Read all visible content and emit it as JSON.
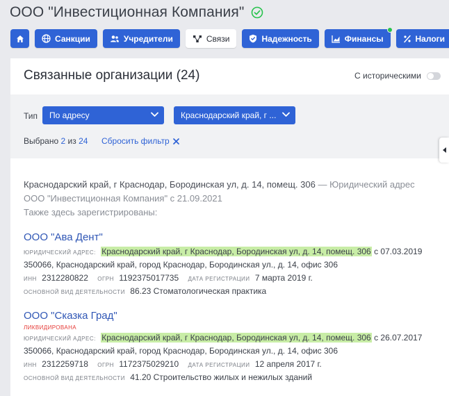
{
  "header": {
    "company_name": "ООО \"Инвестиционная Компания\""
  },
  "nav": {
    "items": [
      {
        "label": "Санкции"
      },
      {
        "label": "Учредители"
      },
      {
        "label": "Связи"
      },
      {
        "label": "Надежность"
      },
      {
        "label": "Финансы"
      },
      {
        "label": "Налоги"
      }
    ]
  },
  "panel": {
    "title": "Связанные организации (24)",
    "historic_label": "С историческими",
    "historic_enabled": false,
    "filter": {
      "type_label": "Тип",
      "type_value": "По адресу",
      "address_value": "Краснодарский край, г ...",
      "selected_prefix": "Выбрано",
      "selected_count": "2",
      "selected_of": "из",
      "selected_total": "24",
      "reset_label": "Сбросить фильтр"
    },
    "intro": {
      "line1_address": "Краснодарский край, г Краснодар, Бородинская ул, д. 14, помещ. 306",
      "line1_suffix": "— Юридический адрес",
      "line2": "ООО \"Инвестиционная Компания\" с 21.09.2021",
      "line3": "Также здесь зарегистрированы:"
    },
    "orgs": [
      {
        "name": "ООО \"Ава Дент\"",
        "status": "",
        "legal_address_label": "ЮРИДИЧЕСКИЙ АДРЕС:",
        "legal_address": "Краснодарский край, г Краснодар, Бородинская ул, д. 14, помещ. 306",
        "since": "с 07.03.2019",
        "postal_address": "350066, Краснодарский край, город Краснодар, Бородинская ул., д. 14, офис 306",
        "inn_label": "ИНН",
        "inn": "2312280822",
        "ogrn_label": "ОГРН",
        "ogrn": "1192375017735",
        "reg_label": "ДАТА РЕГИСТРАЦИИ",
        "reg_date": "7 марта 2019 г.",
        "activity_label": "ОСНОВНОЙ ВИД ДЕЯТЕЛЬНОСТИ",
        "activity": "86.23 Стоматологическая практика"
      },
      {
        "name": "ООО \"Сказка Град\"",
        "status": "ЛИКВИДИРОВАНА",
        "legal_address_label": "ЮРИДИЧЕСКИЙ АДРЕС:",
        "legal_address": "Краснодарский край, г Краснодар, Бородинская ул, д. 14, помещ. 306",
        "since": "с 26.07.2017",
        "postal_address": "350066, Краснодарский край, город Краснодар, Бородинская ул., д. 14, офис 306",
        "inn_label": "ИНН",
        "inn": "2312259718",
        "ogrn_label": "ОГРН",
        "ogrn": "1172375029210",
        "reg_label": "ДАТА РЕГИСТРАЦИИ",
        "reg_date": "12 апреля 2017 г.",
        "activity_label": "ОСНОВНОЙ ВИД ДЕЯТЕЛЬНОСТИ",
        "activity": "41.20 Строительство жилых и нежилых зданий"
      }
    ]
  },
  "colors": {
    "accent": "#2f63d6",
    "highlight": "#c8eda6",
    "liquidated": "#e53935",
    "verified": "#27c24c"
  },
  "icons": [
    "check-circle-icon",
    "home-icon",
    "globe-icon",
    "users-icon",
    "connections-icon",
    "shield-icon",
    "chart-icon",
    "percent-icon",
    "chevron-down-icon",
    "close-icon",
    "chevron-left-icon"
  ]
}
